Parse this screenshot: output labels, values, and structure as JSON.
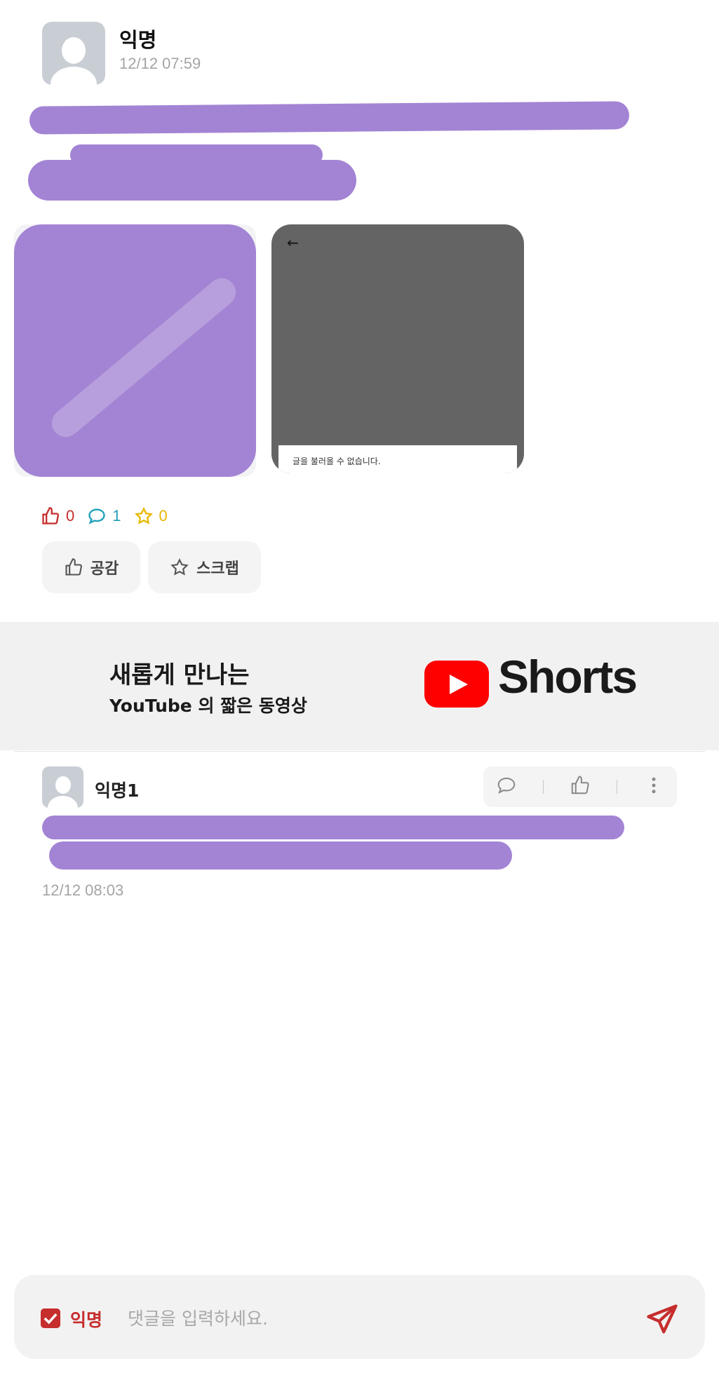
{
  "post": {
    "author": "익명",
    "time": "12/12 07:59",
    "image_error_text": "글을 불러올 수 없습니다.",
    "stats": {
      "likes": "0",
      "comments": "1",
      "scraps": "0"
    },
    "buttons": {
      "like": "공감",
      "scrap": "스크랩"
    }
  },
  "ad": {
    "line1": "새롭게 만나는",
    "line2": "YouTube 의 짧은 동영상",
    "brand": "Shorts"
  },
  "comment": {
    "author": "익명1",
    "time": "12/12 08:03"
  },
  "composer": {
    "anonymous_label": "익명",
    "anonymous_checked": true,
    "placeholder": "댓글을 입력하세요."
  },
  "colors": {
    "accent": "#c62d2d",
    "comment_count": "#1f9fb8",
    "scrap_count": "#e8b800",
    "redaction": "#a283d4"
  }
}
